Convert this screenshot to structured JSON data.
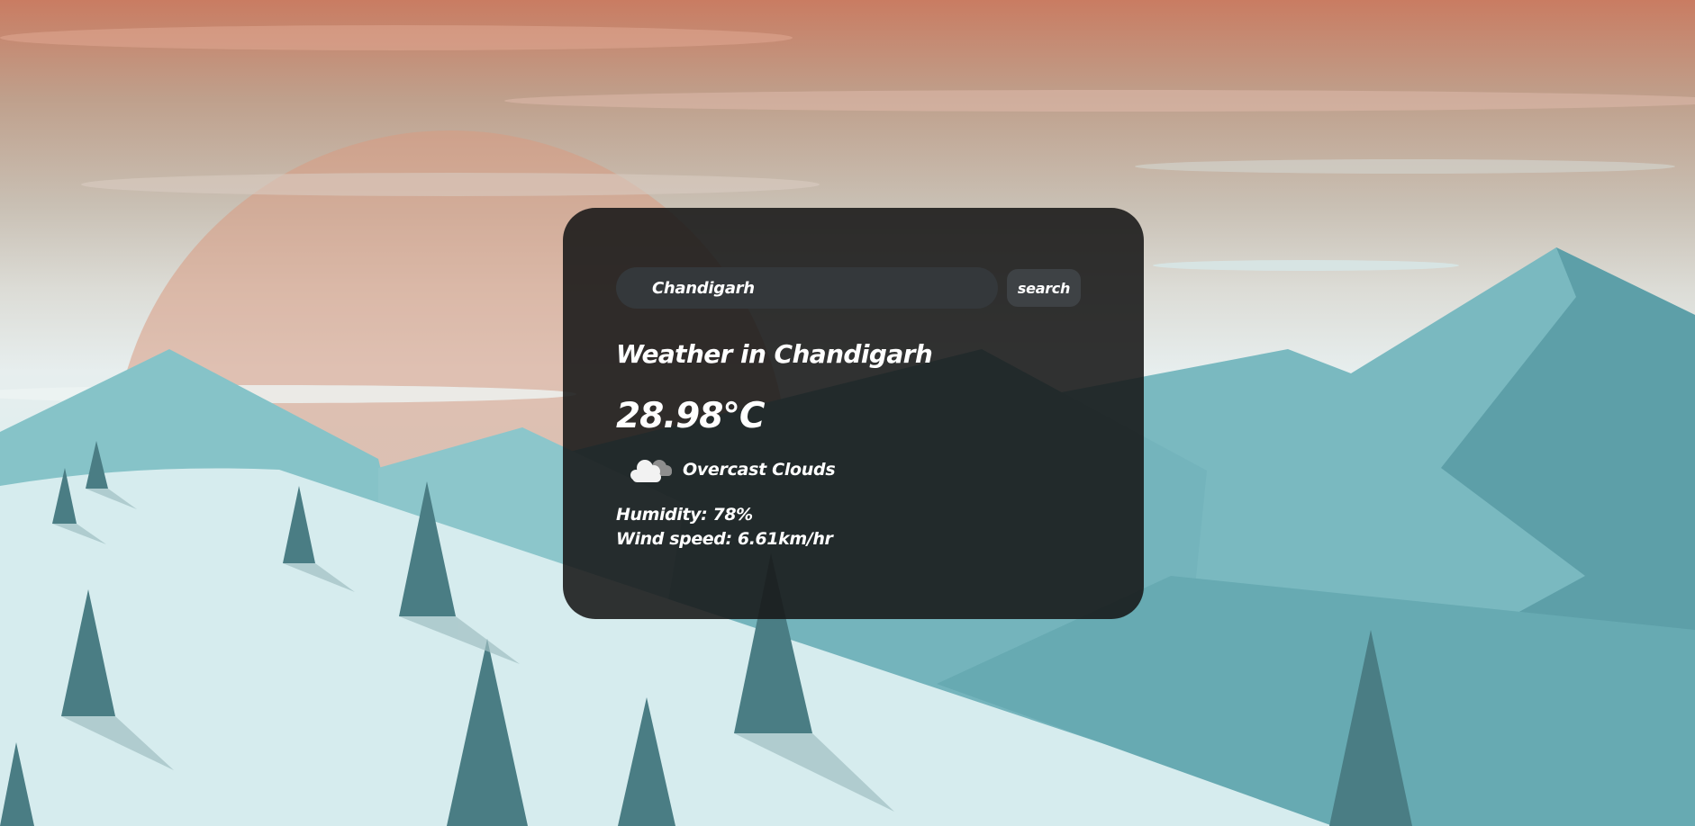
{
  "search": {
    "value": "Chandigarh",
    "button_label": "search"
  },
  "weather": {
    "title": "Weather in Chandigarh",
    "temperature": "28.98°C",
    "icon": "overcast-cloud-icon",
    "description": "Overcast Clouds",
    "humidity": "Humidity: 78%",
    "wind": "Wind speed: 6.61km/hr"
  },
  "colors": {
    "card_background": "#171717",
    "input_background": "#34383b",
    "button_background": "#3e4245",
    "text": "#ffffff",
    "sky_top": "#c97c62",
    "mountain": "#6fb4bc",
    "tree": "#4a7d84"
  }
}
